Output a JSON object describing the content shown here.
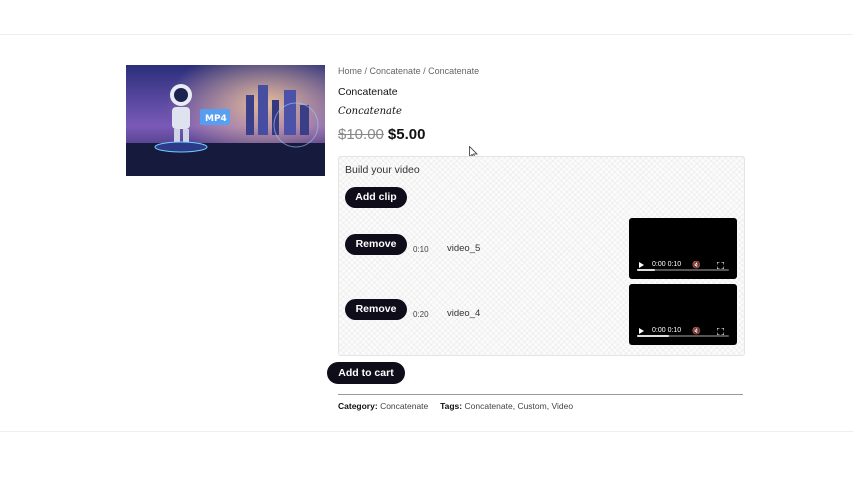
{
  "breadcrumb": {
    "items": [
      "Home",
      "Concatenate",
      "Concatenate"
    ],
    "separator": " / "
  },
  "product": {
    "title": "Concatenate",
    "subtitle": "Concatenate",
    "old_price": "$10.00",
    "new_price": "$5.00",
    "image_text": "MP4"
  },
  "builder": {
    "heading": "Build your video",
    "add_clip_label": "Add clip",
    "clips": [
      {
        "remove_label": "Remove",
        "duration": "0:10",
        "name": "video_5",
        "player_time": "0:00 0:10",
        "progress": 0.2
      },
      {
        "remove_label": "Remove",
        "duration": "0:20",
        "name": "video_4",
        "player_time": "0:00 0:10",
        "progress": 0.35
      }
    ]
  },
  "cart": {
    "add_to_cart_label": "Add to cart"
  },
  "meta": {
    "category_label": "Category:",
    "category_value": "Concatenate",
    "tags_label": "Tags:",
    "tags": [
      "Concatenate",
      "Custom",
      "Video"
    ]
  },
  "colors": {
    "button_bg": "#0f0d1a",
    "button_text": "#ffffff"
  }
}
